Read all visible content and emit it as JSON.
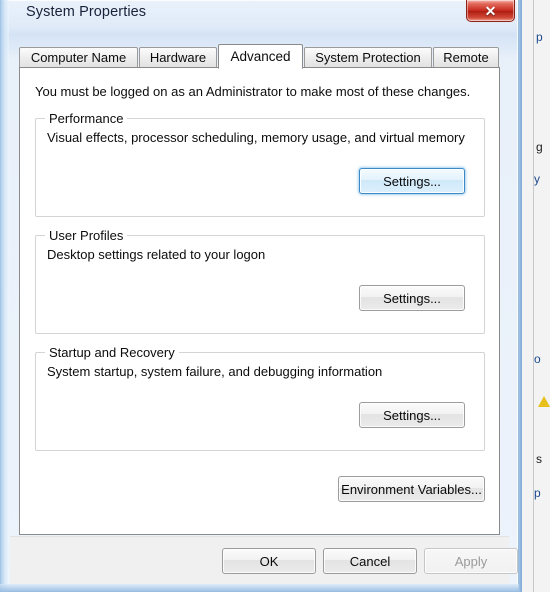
{
  "window": {
    "title": "System Properties",
    "close_label": "✕"
  },
  "tabs": [
    {
      "label": "Computer Name",
      "active": false
    },
    {
      "label": "Hardware",
      "active": false
    },
    {
      "label": "Advanced",
      "active": true
    },
    {
      "label": "System Protection",
      "active": false
    },
    {
      "label": "Remote",
      "active": false
    }
  ],
  "panel": {
    "admin_note": "You must be logged on as an Administrator to make most of these changes.",
    "groups": [
      {
        "label": "Performance",
        "description": "Visual effects, processor scheduling, memory usage, and virtual memory",
        "button_label": "Settings...",
        "button_focused": true
      },
      {
        "label": "User Profiles",
        "description": "Desktop settings related to your logon",
        "button_label": "Settings...",
        "button_focused": false
      },
      {
        "label": "Startup and Recovery",
        "description": "System startup, system failure, and debugging information",
        "button_label": "Settings...",
        "button_focused": false
      }
    ],
    "environment_variables_label": "Environment Variables..."
  },
  "footer": {
    "ok_label": "OK",
    "cancel_label": "Cancel",
    "apply_label": "Apply",
    "apply_disabled": true
  },
  "background": {
    "fragments": [
      {
        "text": "p",
        "color": "blue"
      },
      {
        "text": "g",
        "color": "dark"
      },
      {
        "text": "y",
        "color": "blue"
      },
      {
        "text": "o",
        "color": "blue"
      },
      {
        "text": "s",
        "color": "dark"
      },
      {
        "text": "p",
        "color": "blue"
      }
    ]
  },
  "colors": {
    "accent_blue": "#3c8ac8",
    "close_red": "#c5271a",
    "panel_white": "#ffffff",
    "footer_gray": "#f0f0f0",
    "glass_blue": "#d4e3f5"
  }
}
